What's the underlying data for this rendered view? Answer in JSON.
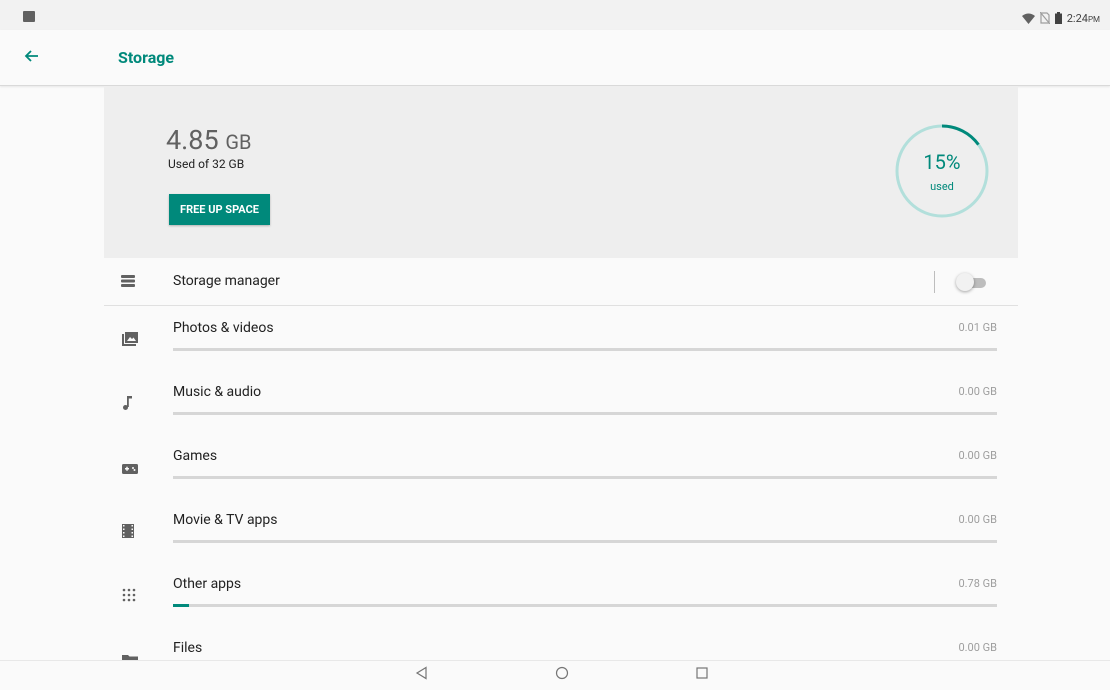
{
  "status_bar": {
    "time": "2:24",
    "time_suffix": "PM"
  },
  "app_bar": {
    "title": "Storage"
  },
  "summary": {
    "used_value": "4.85",
    "used_unit": "GB",
    "used_of": "Used of 32 GB",
    "button_label": "FREE UP SPACE",
    "percent_text": "15%",
    "percent_label": "used",
    "percent_fraction": 0.15
  },
  "storage_manager": {
    "label": "Storage manager",
    "enabled": false
  },
  "categories": [
    {
      "label": "Photos & videos",
      "size": "0.01 GB",
      "fraction": 0.0,
      "icon": "photo-icon"
    },
    {
      "label": "Music & audio",
      "size": "0.00 GB",
      "fraction": 0.0,
      "icon": "music-note-icon"
    },
    {
      "label": "Games",
      "size": "0.00 GB",
      "fraction": 0.0,
      "icon": "gamepad-icon"
    },
    {
      "label": "Movie & TV apps",
      "size": "0.00 GB",
      "fraction": 0.0,
      "icon": "film-icon"
    },
    {
      "label": "Other apps",
      "size": "0.78 GB",
      "fraction": 0.02,
      "icon": "apps-grid-icon"
    },
    {
      "label": "Files",
      "size": "0.00 GB",
      "fraction": 0.0,
      "icon": "folder-icon"
    }
  ],
  "colors": {
    "accent": "#00897b",
    "track": "#b2dfdb"
  }
}
